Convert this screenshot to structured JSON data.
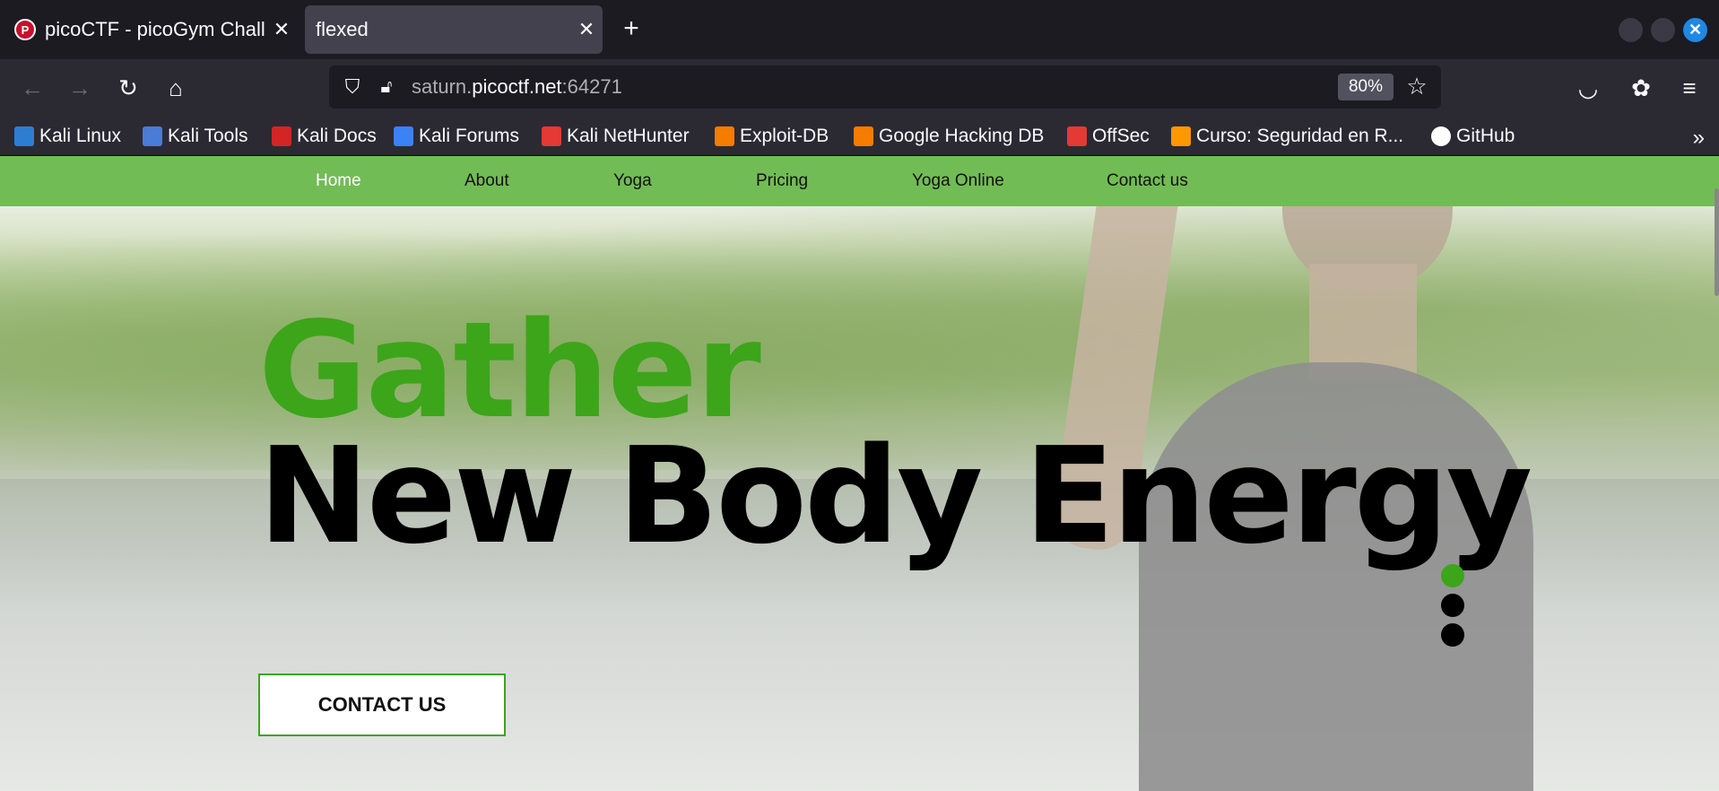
{
  "tabs": [
    {
      "title": "picoCTF - picoGym Chall",
      "favicon_letter": "P",
      "active": false
    },
    {
      "title": "flexed",
      "active": true
    }
  ],
  "toolbar": {
    "url_prefix": "saturn.",
    "url_host": "picoctf.net",
    "url_suffix": ":64271",
    "zoom": "80%"
  },
  "bookmarks": [
    {
      "label": "Kali Linux",
      "icon_color": "#2d7dd2"
    },
    {
      "label": "Kali Tools",
      "icon_color": "#e04b4b"
    },
    {
      "label": "Kali Docs",
      "icon_color": "#d42525"
    },
    {
      "label": "Kali Forums",
      "icon_color": "#3b82f6"
    },
    {
      "label": "Kali NetHunter",
      "icon_color": "#e53935"
    },
    {
      "label": "Exploit-DB",
      "icon_color": "#f57c00"
    },
    {
      "label": "Google Hacking DB",
      "icon_color": "#f57c00"
    },
    {
      "label": "OffSec",
      "icon_color": "#e53935"
    },
    {
      "label": "Curso: Seguridad en R...",
      "icon_color": "#ff9800"
    },
    {
      "label": "GitHub",
      "icon_color": "#ffffff"
    }
  ],
  "site": {
    "nav": [
      {
        "label": "Home",
        "active": true
      },
      {
        "label": "About",
        "active": false
      },
      {
        "label": "Yoga",
        "active": false
      },
      {
        "label": "Pricing",
        "active": false
      },
      {
        "label": "Yoga Online",
        "active": false
      },
      {
        "label": "Contact us",
        "active": false
      }
    ],
    "headline_line1": "Gather",
    "headline_line2": "New Body Energy",
    "cta_label": "CONTACT US",
    "slider_dots": 3,
    "slider_active_index": 0,
    "accent_color": "#3ca51a",
    "nav_color": "#72bc55"
  }
}
